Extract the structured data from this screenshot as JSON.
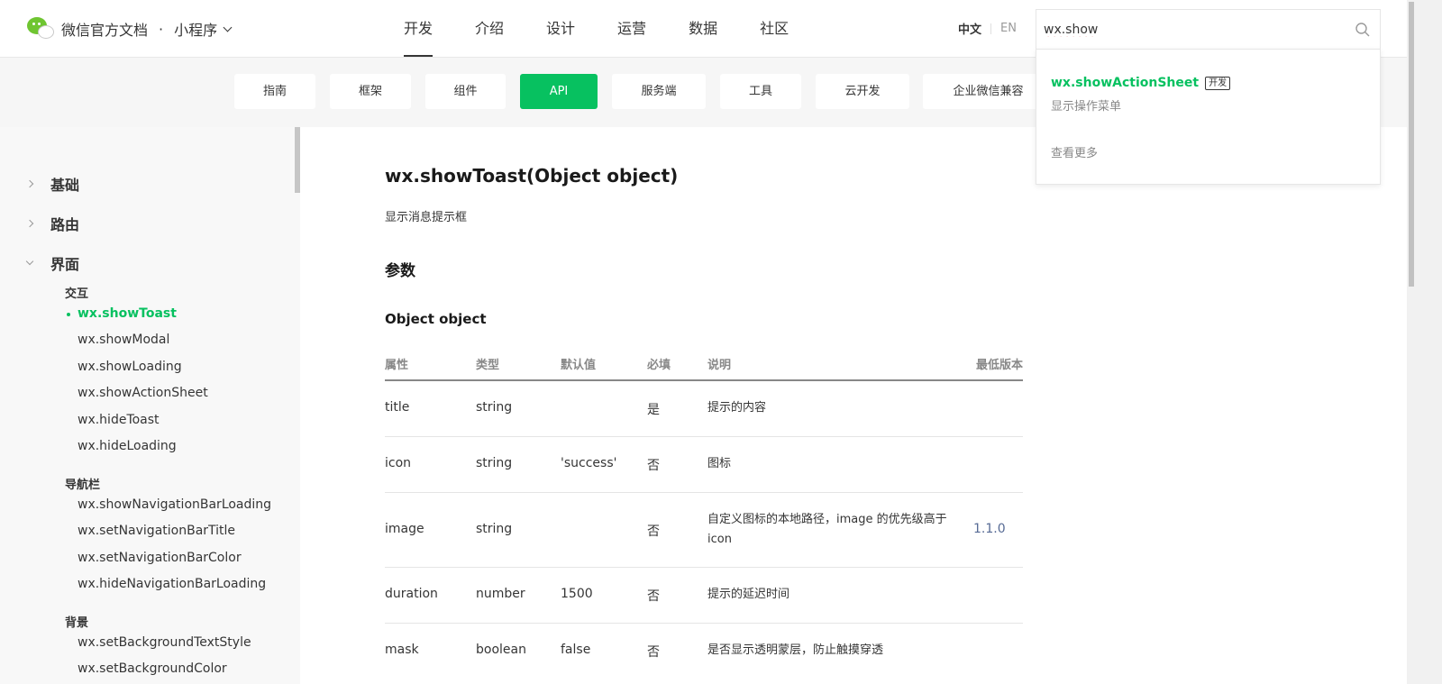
{
  "header": {
    "brand_title": "微信官方文档",
    "brand_dot": "·",
    "brand_sub": "小程序",
    "nav": [
      "开发",
      "介绍",
      "设计",
      "运营",
      "数据",
      "社区"
    ],
    "nav_active_index": 0,
    "lang_zh": "中文",
    "lang_en": "EN",
    "search_value": "wx.show"
  },
  "search_dropdown": {
    "result_title": "wx.showActionSheet",
    "result_tag": "开发",
    "result_desc": "显示操作菜单",
    "more": "查看更多"
  },
  "subnav": {
    "items": [
      "指南",
      "框架",
      "组件",
      "API",
      "服务端",
      "工具",
      "云开发",
      "企业微信兼容"
    ],
    "active_index": 3,
    "active_color": "#07c160"
  },
  "sidebar": {
    "sections": [
      "基础",
      "路由",
      "界面"
    ],
    "groups": [
      {
        "title": "交互",
        "items": [
          "wx.showToast",
          "wx.showModal",
          "wx.showLoading",
          "wx.showActionSheet",
          "wx.hideToast",
          "wx.hideLoading"
        ]
      },
      {
        "title": "导航栏",
        "items": [
          "wx.showNavigationBarLoading",
          "wx.setNavigationBarTitle",
          "wx.setNavigationBarColor",
          "wx.hideNavigationBarLoading"
        ]
      },
      {
        "title": "背景",
        "items": [
          "wx.setBackgroundTextStyle",
          "wx.setBackgroundColor"
        ]
      }
    ],
    "active_item": "wx.showToast"
  },
  "content": {
    "title": "wx.showToast(Object object)",
    "desc": "显示消息提示框",
    "params_heading": "参数",
    "object_heading": "Object object",
    "table": {
      "headers": [
        "属性",
        "类型",
        "默认值",
        "必填",
        "说明",
        "最低版本"
      ],
      "rows": [
        [
          "title",
          "string",
          "",
          "是",
          "提示的内容",
          ""
        ],
        [
          "icon",
          "string",
          "'success'",
          "否",
          "图标",
          ""
        ],
        [
          "image",
          "string",
          "",
          "否",
          "自定义图标的本地路径，image 的优先级高于 icon",
          "1.1.0"
        ],
        [
          "duration",
          "number",
          "1500",
          "否",
          "提示的延迟时间",
          ""
        ],
        [
          "mask",
          "boolean",
          "false",
          "否",
          "是否显示透明蒙层，防止触摸穿透",
          ""
        ]
      ]
    }
  }
}
